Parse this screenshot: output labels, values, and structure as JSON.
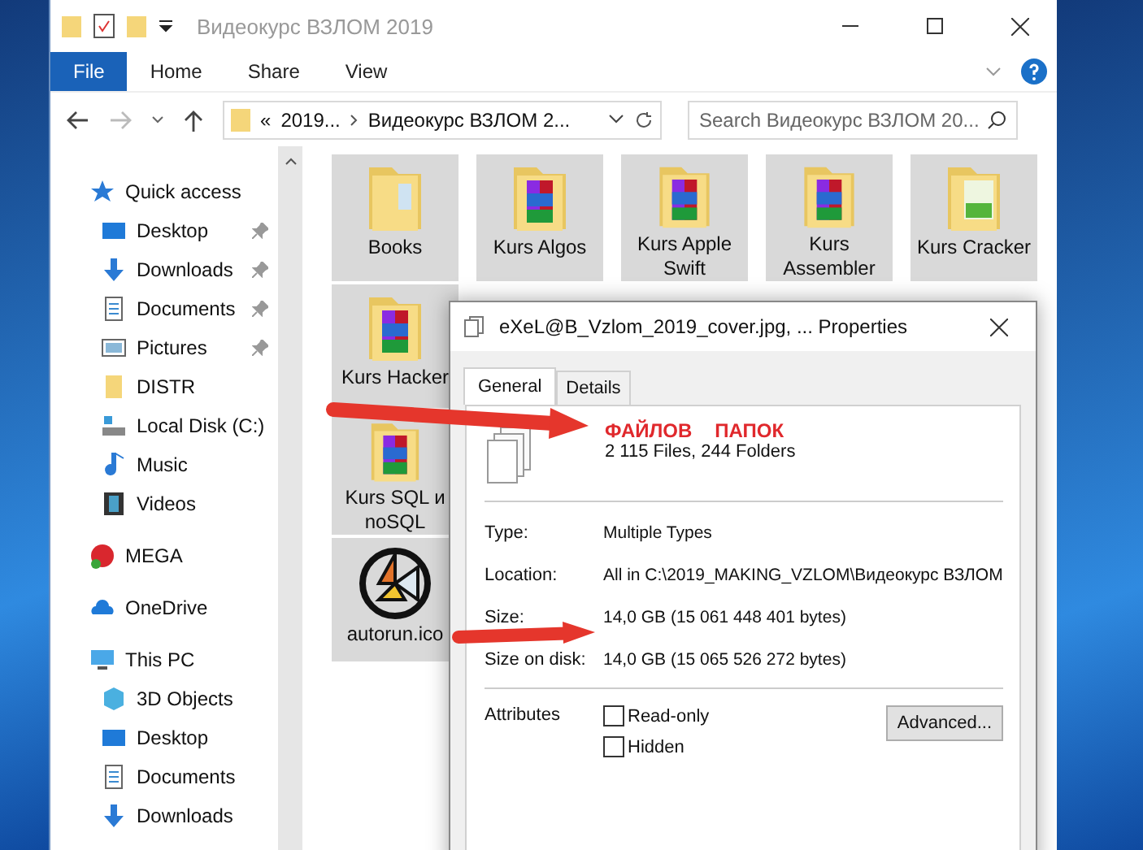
{
  "window": {
    "title": "Видеокурс ВЗЛОМ 2019"
  },
  "ribbon_tabs": [
    {
      "label": "File",
      "selected": true
    },
    {
      "label": "Home",
      "selected": false
    },
    {
      "label": "Share",
      "selected": false
    },
    {
      "label": "View",
      "selected": false
    }
  ],
  "address": {
    "overflow": "«",
    "parts": [
      "2019...",
      "Видеокурс ВЗЛОМ 2..."
    ]
  },
  "search": {
    "placeholder": "Search Видеокурс ВЗЛОМ 20..."
  },
  "sidebar": [
    {
      "label": "Quick access",
      "kind": "star",
      "children": [
        {
          "label": "Desktop",
          "kind": "desktop",
          "pinned": true
        },
        {
          "label": "Downloads",
          "kind": "download",
          "pinned": true
        },
        {
          "label": "Documents",
          "kind": "document",
          "pinned": true
        },
        {
          "label": "Pictures",
          "kind": "picture",
          "pinned": true
        },
        {
          "label": "DISTR",
          "kind": "folder",
          "pinned": false
        },
        {
          "label": "Local Disk (C:)",
          "kind": "disk",
          "pinned": false
        },
        {
          "label": "Music",
          "kind": "music",
          "pinned": false
        },
        {
          "label": "Videos",
          "kind": "video",
          "pinned": false
        }
      ]
    },
    {
      "label": "MEGA",
      "kind": "mega"
    },
    {
      "label": "OneDrive",
      "kind": "cloud"
    },
    {
      "label": "This PC",
      "kind": "pc",
      "children": [
        {
          "label": "3D Objects",
          "kind": "cube",
          "pinned": false
        },
        {
          "label": "Desktop",
          "kind": "desktop",
          "pinned": false
        },
        {
          "label": "Documents",
          "kind": "document",
          "pinned": false
        },
        {
          "label": "Downloads",
          "kind": "download",
          "pinned": false
        }
      ]
    }
  ],
  "files": [
    {
      "name": "Books",
      "kind": "folder"
    },
    {
      "name": "Kurs Algos",
      "kind": "archive"
    },
    {
      "name": "Kurs Apple Swift",
      "kind": "archive"
    },
    {
      "name": "Kurs Assembler",
      "kind": "archive"
    },
    {
      "name": "Kurs Cracker",
      "kind": "image"
    },
    {
      "name": "Kurs Hacker",
      "kind": "archive"
    },
    {
      "name": "Kurs SQL и noSQL",
      "kind": "archive"
    },
    {
      "name": "autorun.ico",
      "kind": "icon"
    }
  ],
  "dialog": {
    "title": "eXeL@B_Vzlom_2019_cover.jpg, ... Properties",
    "tabs": [
      {
        "label": "General",
        "selected": true
      },
      {
        "label": "Details",
        "selected": false
      }
    ],
    "annotations": [
      "ФАЙЛОВ",
      "ПАПОК"
    ],
    "summary": "2 115 Files, 244 Folders",
    "fields": [
      {
        "label": "Type:",
        "value": "Multiple Types"
      },
      {
        "label": "Location:",
        "value": "All in C:\\2019_MAKING_VZLOM\\Видеокурс ВЗЛОМ"
      },
      {
        "label": "Size:",
        "value": "14,0 GB (15 061 448 401 bytes)"
      },
      {
        "label": "Size on disk:",
        "value": "14,0 GB (15 065 526 272 bytes)"
      }
    ],
    "attributes_label": "Attributes",
    "attributes": [
      {
        "label": "Read-only",
        "checked": false
      },
      {
        "label": "Hidden",
        "checked": false
      }
    ],
    "advanced_button": "Advanced..."
  }
}
